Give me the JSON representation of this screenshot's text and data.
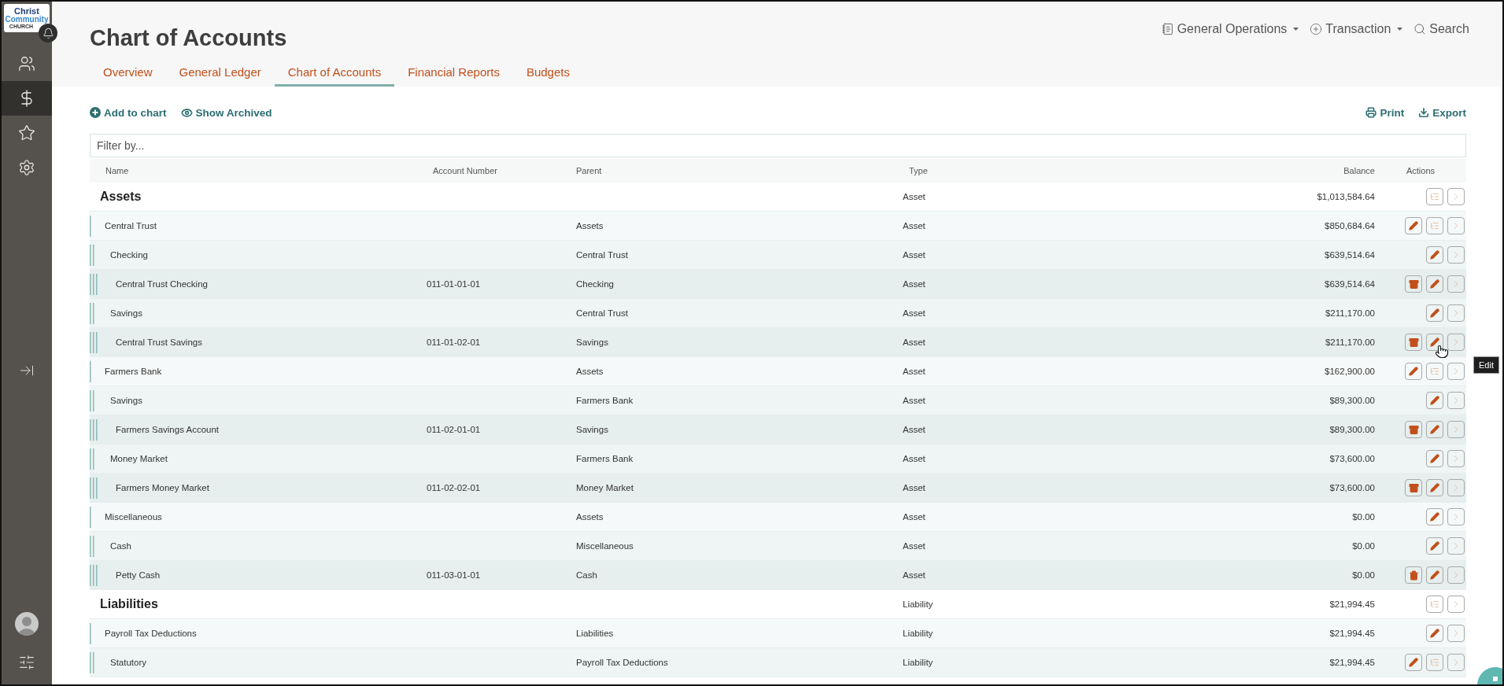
{
  "logo": {
    "line1": "Christ",
    "line2": "Community",
    "line3": "CHURCH"
  },
  "sidebar": {
    "items": [
      {
        "kind": "people",
        "selected": false
      },
      {
        "kind": "dollar",
        "selected": true
      },
      {
        "kind": "star",
        "selected": false
      },
      {
        "kind": "gear",
        "selected": false
      }
    ]
  },
  "title": "Chart of Accounts",
  "top_menu": [
    {
      "kind": "notebook",
      "label": "General Operations",
      "dropdown": true
    },
    {
      "kind": "plus",
      "label": "Transaction",
      "dropdown": true
    },
    {
      "kind": "search",
      "label": "Search",
      "dropdown": false
    }
  ],
  "tabs": [
    {
      "label": "Overview",
      "selected": false
    },
    {
      "label": "General Ledger",
      "selected": false
    },
    {
      "label": "Chart of Accounts",
      "selected": true
    },
    {
      "label": "Financial Reports",
      "selected": false
    },
    {
      "label": "Budgets",
      "selected": false
    }
  ],
  "toolbar": [
    {
      "kind": "add",
      "label": "Add to chart"
    },
    {
      "kind": "eye",
      "label": "Show Archived"
    }
  ],
  "toolbar_right": [
    {
      "kind": "print",
      "label": "Print"
    },
    {
      "kind": "export",
      "label": "Export"
    }
  ],
  "filter": {
    "placeholder": "Filter by..."
  },
  "columns": [
    "Name",
    "Account Number",
    "Parent",
    "Type",
    "Balance",
    "Actions"
  ],
  "groups": [
    {
      "name": "Assets",
      "type": "Asset",
      "balance": "$1,013,584.64",
      "actions": [
        {
          "kind": "subaccounts"
        },
        {
          "kind": "open"
        }
      ],
      "children": [
        {
          "name": "Central Trust",
          "parent": "Assets",
          "type": "Asset",
          "balance": "$850,684.64",
          "actions": [
            {
              "kind": "edit"
            },
            {
              "kind": "subaccounts"
            },
            {
              "kind": "open"
            }
          ],
          "children": [
            {
              "name": "Checking",
              "parent": "Central Trust",
              "type": "Asset",
              "balance": "$639,514.64",
              "actions": [
                {
                  "kind": "edit"
                },
                {
                  "kind": "open"
                }
              ],
              "children": [
                {
                  "name": "Central Trust Checking",
                  "number": "011-01-01-01",
                  "parent": "Checking",
                  "type": "Asset",
                  "balance": "$639,514.64",
                  "actions": [
                    {
                      "kind": "archive"
                    },
                    {
                      "kind": "edit"
                    },
                    {
                      "kind": "open"
                    }
                  ]
                }
              ]
            },
            {
              "name": "Savings",
              "parent": "Central Trust",
              "type": "Asset",
              "balance": "$211,170.00",
              "actions": [
                {
                  "kind": "edit"
                },
                {
                  "kind": "open"
                }
              ],
              "children": [
                {
                  "name": "Central Trust Savings",
                  "number": "011-01-02-01",
                  "parent": "Savings",
                  "type": "Asset",
                  "balance": "$211,170.00",
                  "actions": [
                    {
                      "kind": "archive"
                    },
                    {
                      "kind": "edit",
                      "tooltip": "Edit"
                    },
                    {
                      "kind": "open"
                    }
                  ]
                }
              ]
            }
          ]
        },
        {
          "name": "Farmers Bank",
          "parent": "Assets",
          "type": "Asset",
          "balance": "$162,900.00",
          "actions": [
            {
              "kind": "edit"
            },
            {
              "kind": "subaccounts"
            },
            {
              "kind": "open"
            }
          ],
          "children": [
            {
              "name": "Savings",
              "parent": "Farmers Bank",
              "type": "Asset",
              "balance": "$89,300.00",
              "actions": [
                {
                  "kind": "edit"
                },
                {
                  "kind": "open"
                }
              ],
              "children": [
                {
                  "name": "Farmers Savings Account",
                  "number": "011-02-01-01",
                  "parent": "Savings",
                  "type": "Asset",
                  "balance": "$89,300.00",
                  "actions": [
                    {
                      "kind": "archive"
                    },
                    {
                      "kind": "edit"
                    },
                    {
                      "kind": "open"
                    }
                  ]
                }
              ]
            },
            {
              "name": "Money Market",
              "parent": "Farmers Bank",
              "type": "Asset",
              "balance": "$73,600.00",
              "actions": [
                {
                  "kind": "edit"
                },
                {
                  "kind": "open"
                }
              ],
              "children": [
                {
                  "name": "Farmers Money Market",
                  "number": "011-02-02-01",
                  "parent": "Money Market",
                  "type": "Asset",
                  "balance": "$73,600.00",
                  "actions": [
                    {
                      "kind": "archive"
                    },
                    {
                      "kind": "edit"
                    },
                    {
                      "kind": "open"
                    }
                  ]
                }
              ]
            }
          ]
        },
        {
          "name": "Miscellaneous",
          "parent": "Assets",
          "type": "Asset",
          "balance": "$0.00",
          "actions": [
            {
              "kind": "edit"
            },
            {
              "kind": "open"
            }
          ],
          "children": [
            {
              "name": "Cash",
              "parent": "Miscellaneous",
              "type": "Asset",
              "balance": "$0.00",
              "actions": [
                {
                  "kind": "edit"
                },
                {
                  "kind": "open"
                }
              ],
              "children": [
                {
                  "name": "Petty Cash",
                  "number": "011-03-01-01",
                  "parent": "Cash",
                  "type": "Asset",
                  "balance": "$0.00",
                  "actions": [
                    {
                      "kind": "delete"
                    },
                    {
                      "kind": "edit"
                    },
                    {
                      "kind": "open"
                    }
                  ]
                }
              ]
            }
          ]
        }
      ]
    },
    {
      "name": "Liabilities",
      "type": "Liability",
      "balance": "$21,994.45",
      "actions": [
        {
          "kind": "subaccounts"
        },
        {
          "kind": "open"
        }
      ],
      "children": [
        {
          "name": "Payroll Tax Deductions",
          "parent": "Liabilities",
          "type": "Liability",
          "balance": "$21,994.45",
          "actions": [
            {
              "kind": "edit"
            },
            {
              "kind": "open"
            }
          ],
          "children": [
            {
              "name": "Statutory",
              "parent": "Payroll Tax Deductions",
              "type": "Liability",
              "balance": "$21,994.45",
              "actions": [
                {
                  "kind": "edit"
                },
                {
                  "kind": "subaccounts"
                },
                {
                  "kind": "open"
                }
              ]
            }
          ]
        }
      ]
    }
  ]
}
